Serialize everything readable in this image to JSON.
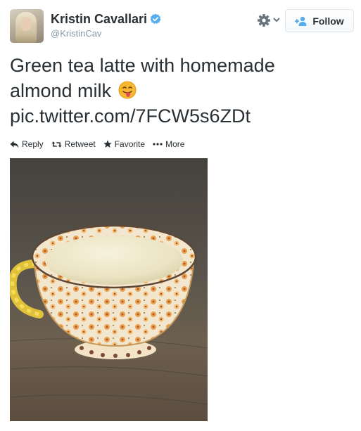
{
  "tweet": {
    "author": {
      "name": "Kristin Cavallari",
      "handle": "@KristinCav"
    },
    "follow_label": "Follow",
    "text_lines": [
      "Green tea latte with homemade",
      "almond milk"
    ],
    "link_text": "pic.twitter.com/7FCW5s6ZDt",
    "actions": [
      {
        "label": "Reply",
        "icon": "reply-icon"
      },
      {
        "label": "Retweet",
        "icon": "retweet-icon"
      },
      {
        "label": "Favorite",
        "icon": "star-icon"
      },
      {
        "label": "More",
        "icon": "more-dots-icon"
      }
    ],
    "emoji": "tongue-out-emoji"
  },
  "colors": {
    "text": "#292f33",
    "muted": "#8899a6",
    "verified_blue": "#55acee",
    "follow_icon_blue": "#55acee"
  }
}
